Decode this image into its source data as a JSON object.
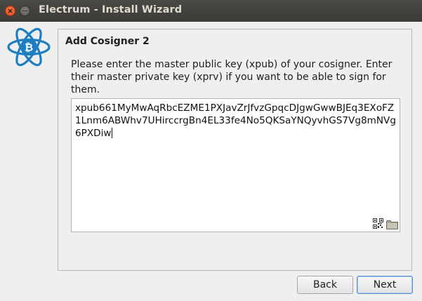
{
  "window": {
    "title": "Electrum  -  Install Wizard"
  },
  "wizard": {
    "heading": "Add Cosigner 2",
    "instructions": "Please enter the master public key (xpub) of your cosigner. Enter their master private key (xprv) if you want to be able to sign for them.",
    "key_value": "xpub661MyMwAqRbcEZME1PXJavZrJfvzGpqcDJgwGwwBJEq3EXoFZ1Lnm6ABWhv7UHirccrgBn4EL33fe4No5QKSaYNQyvhGS7Vg8mNVg6PXDiw"
  },
  "buttons": {
    "back": "Back",
    "next": "Next"
  },
  "icons": {
    "close": "close-icon",
    "minimize": "minimize-icon",
    "logo": "electrum-logo",
    "qr": "qr-code-icon",
    "folder": "folder-icon"
  },
  "colors": {
    "titlebar": "#3c3b37",
    "close_button": "#df4a16",
    "logo_blue": "#1e7ec2",
    "focus_border": "#5b8fd0"
  }
}
